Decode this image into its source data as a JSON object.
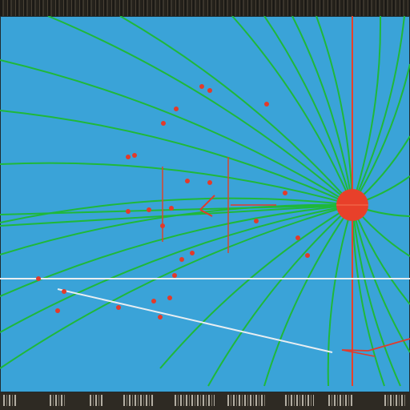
{
  "colors": {
    "background": "#3aa3d8",
    "field_line": "#1fb83a",
    "charge": "#e8402a",
    "particle": "#e33a2a",
    "white_line": "#e8eef2",
    "frame": "#2a2620"
  },
  "icons": {
    "point_charge": "red-circle-icon"
  }
}
